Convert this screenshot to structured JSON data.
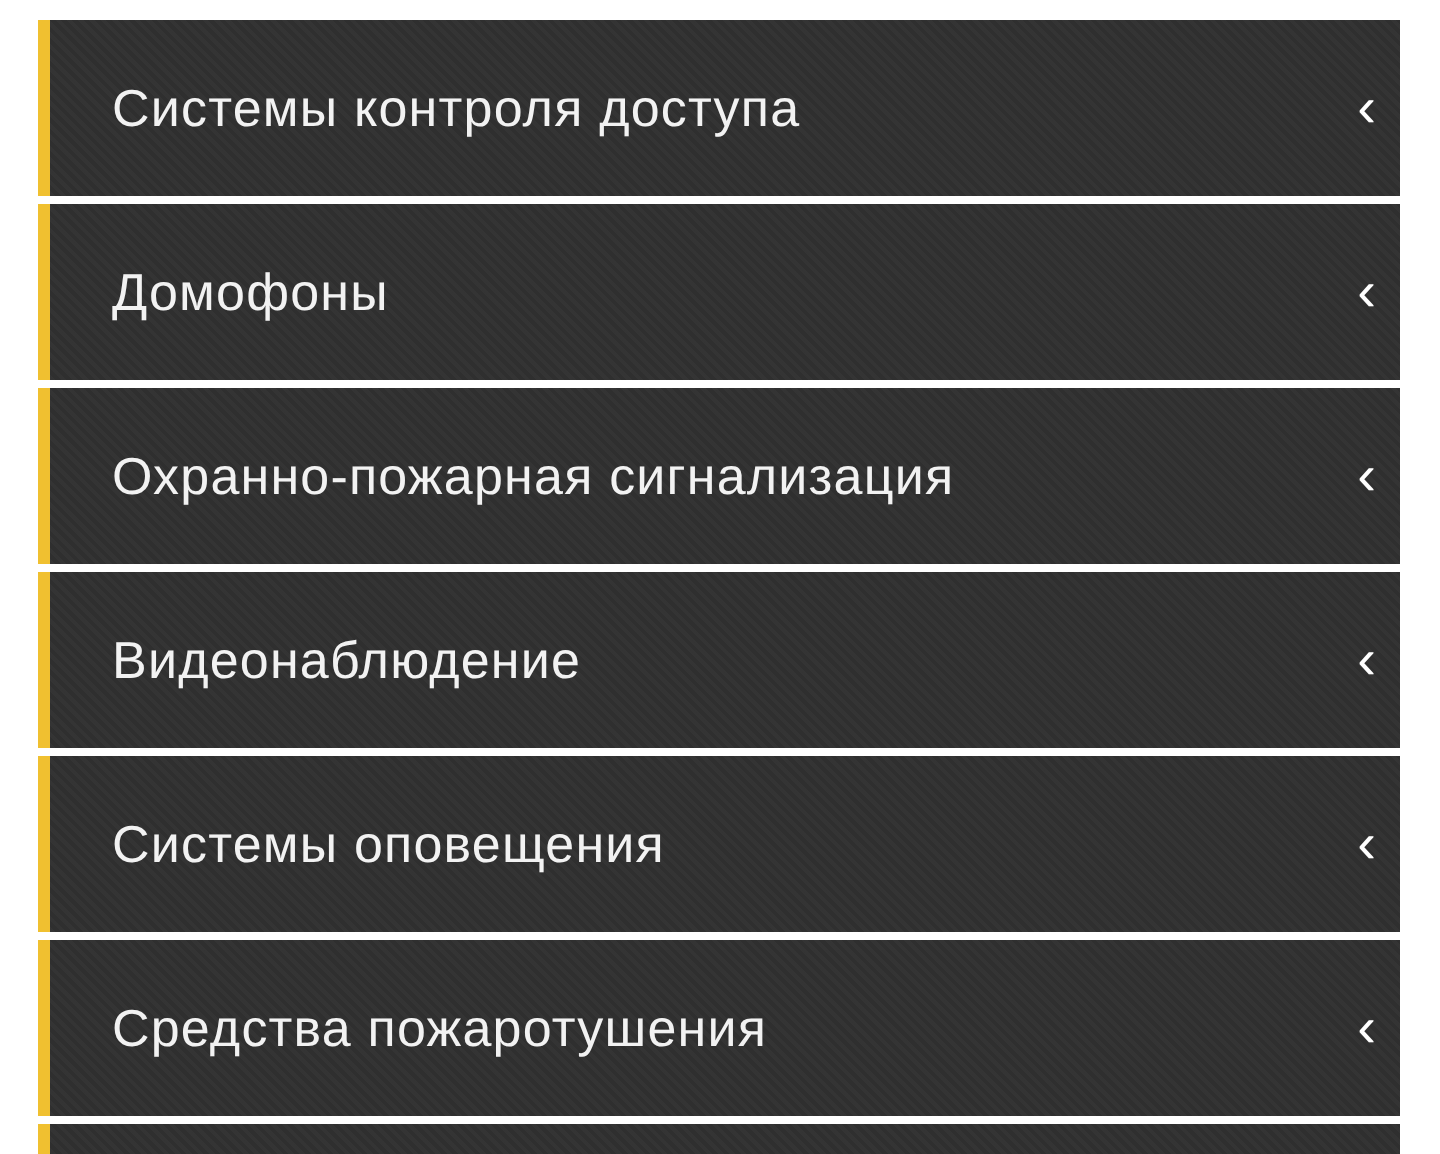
{
  "menu": {
    "items": [
      {
        "label": "Системы контроля доступа",
        "chevron": "‹"
      },
      {
        "label": "Домофоны",
        "chevron": "‹"
      },
      {
        "label": "Охранно-пожарная сигнализация",
        "chevron": "‹"
      },
      {
        "label": "Видеонаблюдение",
        "chevron": "‹"
      },
      {
        "label": "Системы оповещения",
        "chevron": "‹"
      },
      {
        "label": "Средства пожаротушения",
        "chevron": "‹"
      }
    ],
    "more_below": true
  }
}
